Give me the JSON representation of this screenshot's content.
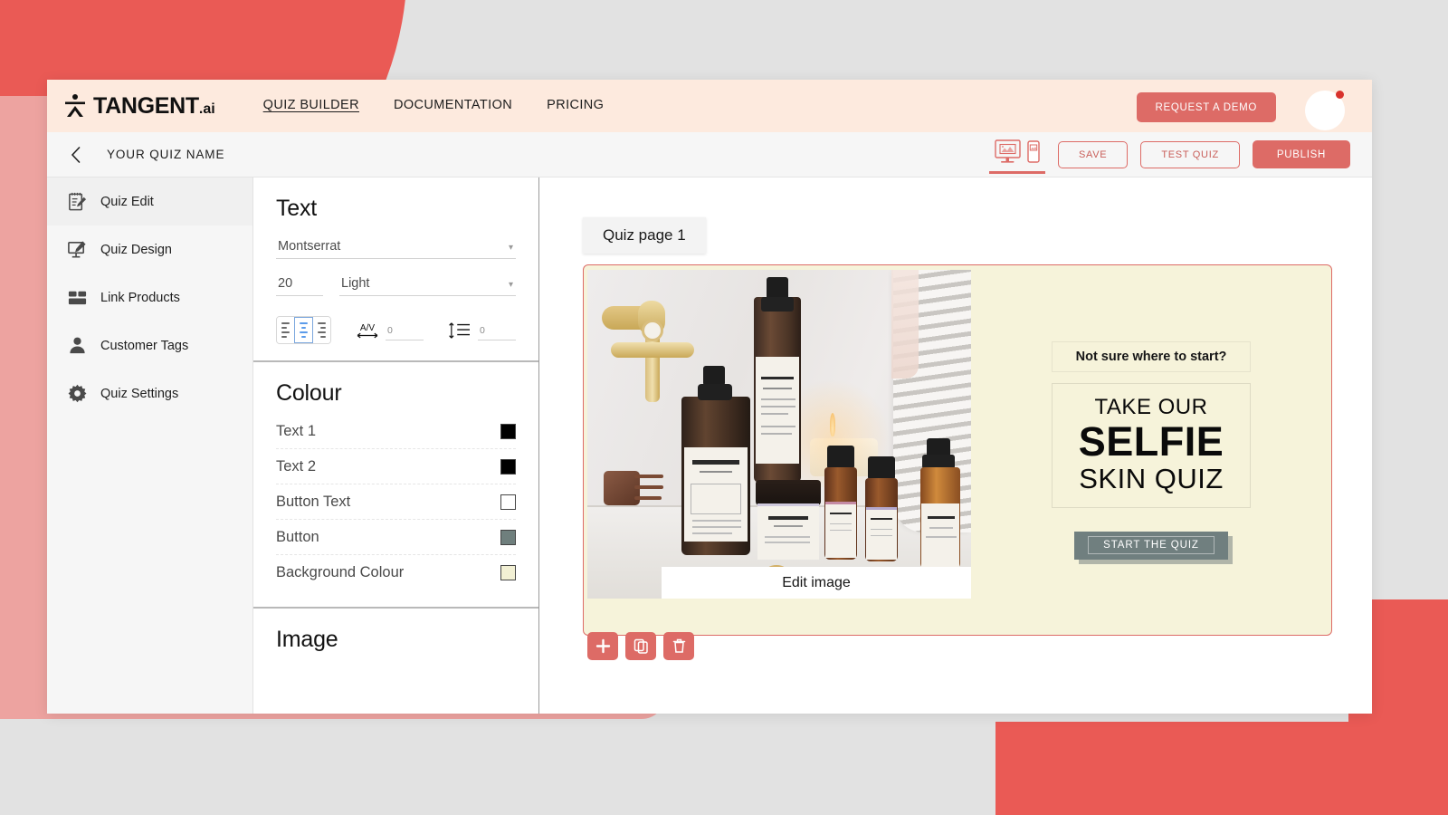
{
  "colors": {
    "brand_red": "#ea5a55",
    "button_red": "#dd6b66",
    "nav_bg": "#fdeade",
    "canvas_bg": "#f6f3da",
    "cta_gray": "#707f7f",
    "page_bg": "#e2e2e2"
  },
  "topnav": {
    "logo_text": "TANGENT",
    "logo_suffix": ".ai",
    "logo_icon": "tangent-logo-icon",
    "links": [
      {
        "label": "QUIZ BUILDER",
        "active": true
      },
      {
        "label": "DOCUMENTATION",
        "active": false
      },
      {
        "label": "PRICING",
        "active": false
      }
    ],
    "demo_button": "REQUEST A DEMO",
    "avatar_icon": "user-avatar",
    "notification_dot": true
  },
  "subbar": {
    "back_icon": "chevron-left-icon",
    "quiz_name": "YOUR QUIZ NAME",
    "device_toggle_icon": "desktop-mobile-preview-icon",
    "save_label": "SAVE",
    "test_label": "TEST QUIZ",
    "publish_label": "PUBLISH"
  },
  "sidebar": {
    "items": [
      {
        "label": "Quiz  Edit",
        "icon": "notepad-pencil-icon",
        "active": true
      },
      {
        "label": "Quiz  Design",
        "icon": "monitor-pencil-icon",
        "active": false
      },
      {
        "label": "Link Products",
        "icon": "products-grid-icon",
        "active": false
      },
      {
        "label": "Customer Tags",
        "icon": "person-icon",
        "active": false
      },
      {
        "label": "Quiz  Settings",
        "icon": "gear-icon",
        "active": false
      }
    ]
  },
  "props": {
    "text": {
      "title": "Text",
      "font_family": "Montserrat",
      "font_size": "20",
      "font_weight": "Light",
      "align_options": [
        "align-left",
        "align-center",
        "align-right"
      ],
      "align_selected": "align-center",
      "letter_spacing_icon": "letter-spacing-icon",
      "letter_spacing_value": "0",
      "line_height_icon": "line-height-icon",
      "line_height_value": "0"
    },
    "colour": {
      "title": "Colour",
      "rows": [
        {
          "label": "Text 1",
          "value": "#000000"
        },
        {
          "label": "Text 2",
          "value": "#000000"
        },
        {
          "label": "Button Text",
          "value": "#ffffff"
        },
        {
          "label": "Button",
          "value": "#6f7f7d"
        },
        {
          "label": "Background Colour",
          "value": "#f2f0d4"
        }
      ]
    },
    "image": {
      "title": "Image"
    }
  },
  "canvas": {
    "page_tab": "Quiz page 1",
    "edit_image_label": "Edit image",
    "slide": {
      "subheading": "Not sure where to start?",
      "heading_line1": "TAKE OUR",
      "heading_line2": "SELFIE",
      "heading_line3": "SKIN QUIZ",
      "cta_label": "START THE QUIZ",
      "image_alt": "m.greengrass skincare product bottles on marble counter"
    },
    "actions": [
      {
        "name": "add-slide",
        "icon": "plus-icon"
      },
      {
        "name": "duplicate-slide",
        "icon": "copy-icon"
      },
      {
        "name": "delete-slide",
        "icon": "trash-icon"
      }
    ]
  }
}
